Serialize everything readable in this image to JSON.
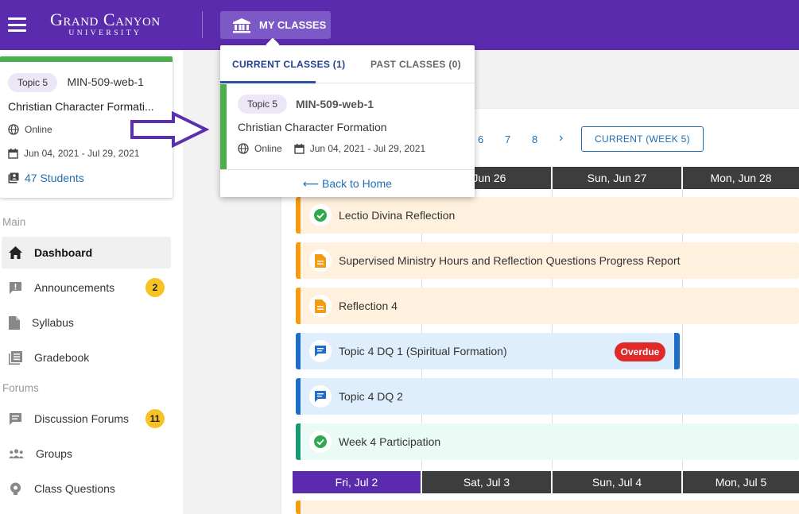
{
  "header": {
    "logo_main": "Grand Canyon",
    "logo_sub": "UNIVERSITY",
    "my_classes_label": "MY CLASSES"
  },
  "class_card": {
    "topic": "Topic 5",
    "code": "MIN-509-web-1",
    "title": "Christian Character Formati...",
    "mode": "Online",
    "dates": "Jun 04, 2021 - Jul 29, 2021",
    "students": "47 Students"
  },
  "nav": {
    "section_main": "Main",
    "section_forums": "Forums",
    "items": [
      {
        "label": "Dashboard"
      },
      {
        "label": "Announcements",
        "badge": "2"
      },
      {
        "label": "Syllabus"
      },
      {
        "label": "Gradebook"
      },
      {
        "label": "Discussion Forums",
        "badge": "11"
      },
      {
        "label": "Groups"
      },
      {
        "label": "Class Questions"
      }
    ]
  },
  "dropdown": {
    "tab_current": "CURRENT CLASSES (1)",
    "tab_past": "PAST CLASSES (0)",
    "class": {
      "topic": "Topic 5",
      "code": "MIN-509-web-1",
      "title": "Christian Character Formation",
      "mode": "Online",
      "dates": "Jun 04, 2021 - Jul 29, 2021"
    },
    "back_label": "⟵ Back to Home"
  },
  "calendar": {
    "pages": [
      "6",
      "7",
      "8",
      "›"
    ],
    "current_week_label": "CURRENT (WEEK 5)",
    "week1_days": [
      ", Jun 26",
      "Sun, Jun 27",
      "Mon, Jun 28"
    ],
    "week2_days": [
      "Fri, Jul 2",
      "Sat, Jul 3",
      "Sun, Jul 4",
      "Mon, Jul 5"
    ],
    "tasks": [
      {
        "label": "Lectio Divina Reflection",
        "type": "check"
      },
      {
        "label": "Supervised Ministry Hours and Reflection Questions Progress Report",
        "type": "doc"
      },
      {
        "label": "Reflection 4",
        "type": "doc"
      },
      {
        "label": "Topic 4 DQ 1 (Spiritual Formation)",
        "type": "chat",
        "status": "Overdue"
      },
      {
        "label": "Topic 4 DQ 2",
        "type": "chat"
      },
      {
        "label": "Week 4 Participation",
        "type": "check"
      }
    ]
  },
  "colors": {
    "brand_purple": "#5b2bae",
    "link_blue": "#1f6fb2",
    "green_accent": "#4cae4c",
    "overdue_red": "#e02a2a",
    "badge_yellow": "#f7c224"
  }
}
